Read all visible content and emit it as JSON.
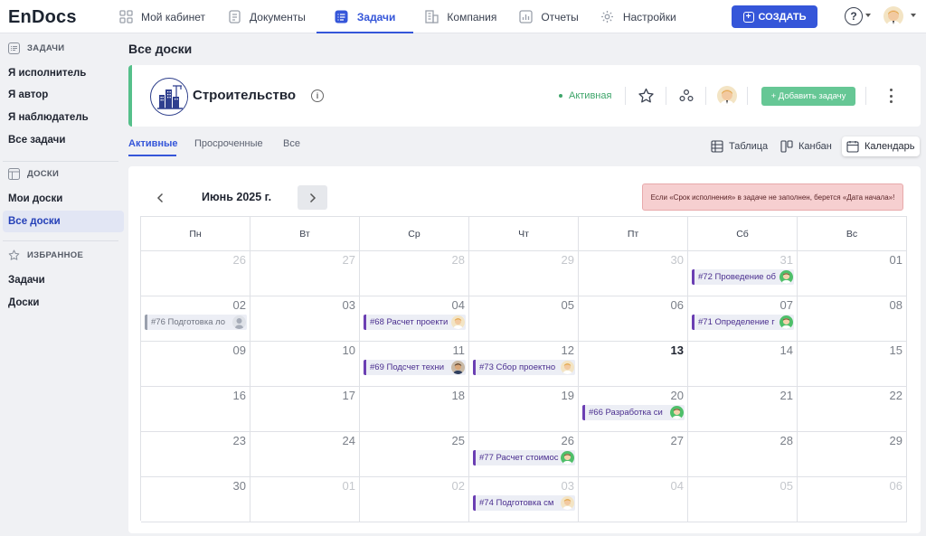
{
  "app": {
    "logo": "EnDocs"
  },
  "nav": {
    "items": [
      {
        "label": "Мой кабинет",
        "icon": "grid-icon"
      },
      {
        "label": "Документы",
        "icon": "document-icon"
      },
      {
        "label": "Задачи",
        "icon": "tasks-icon",
        "active": true
      },
      {
        "label": "Компания",
        "icon": "building-icon"
      },
      {
        "label": "Отчеты",
        "icon": "chart-icon"
      },
      {
        "label": "Настройки",
        "icon": "gear-icon"
      }
    ],
    "create_label": "СОЗДАТЬ",
    "help_label": "?"
  },
  "sidebar": {
    "tasks_heading": "ЗАДАЧИ",
    "tasks_items": [
      "Я исполнитель",
      "Я автор",
      "Я наблюдатель",
      "Все задачи"
    ],
    "boards_heading": "ДОСКИ",
    "boards_items": [
      "Мои доски",
      "Все доски"
    ],
    "favorites_heading": "ИЗБРАННОЕ",
    "favorites_items": [
      "Задачи",
      "Доски"
    ]
  },
  "page": {
    "title": "Все доски"
  },
  "board": {
    "name": "Строительство",
    "info": "i",
    "status": "Активная",
    "add_task_label": "+ Добавить задачу"
  },
  "tabs": [
    "Активные",
    "Просроченные",
    "Все"
  ],
  "views": [
    "Таблица",
    "Канбан",
    "Календарь"
  ],
  "calendar": {
    "month_label": "Июнь 2025 г.",
    "note": "Если «Срок исполнения» в задаче не заполнен, берется «Дата начала»!",
    "weekdays": [
      "Пн",
      "Вт",
      "Ср",
      "Чт",
      "Пт",
      "Сб",
      "Вс"
    ],
    "weeks": [
      [
        "26",
        "27",
        "28",
        "29",
        "30",
        "31",
        "01"
      ],
      [
        "02",
        "03",
        "04",
        "05",
        "06",
        "07",
        "08"
      ],
      [
        "09",
        "10",
        "11",
        "12",
        "13",
        "14",
        "15"
      ],
      [
        "16",
        "17",
        "18",
        "19",
        "20",
        "21",
        "22"
      ],
      [
        "23",
        "24",
        "25",
        "26",
        "27",
        "28",
        "29"
      ],
      [
        "30",
        "01",
        "02",
        "03",
        "04",
        "05",
        "06"
      ]
    ],
    "tasks": [
      {
        "label": "#72 Проведение об",
        "week": 0,
        "day": 5,
        "avatar": "green"
      },
      {
        "label": "#76 Подготовка ло",
        "week": 1,
        "day": 0,
        "avatar": "gray",
        "style": "gray"
      },
      {
        "label": "#68 Расчет проекти",
        "week": 1,
        "day": 2,
        "avatar": "blond"
      },
      {
        "label": "#71 Определение г",
        "week": 1,
        "day": 5,
        "avatar": "green"
      },
      {
        "label": "#69 Подсчет техни",
        "week": 2,
        "day": 2,
        "avatar": "dark"
      },
      {
        "label": "#73 Сбор проектно",
        "week": 2,
        "day": 3,
        "avatar": "blond"
      },
      {
        "label": "#66 Разработка си",
        "week": 3,
        "day": 4,
        "avatar": "green"
      },
      {
        "label": "#77 Расчет стоимос",
        "week": 4,
        "day": 3,
        "avatar": "green"
      },
      {
        "label": "#74 Подготовка см",
        "week": 5,
        "day": 3,
        "avatar": "blond"
      }
    ]
  },
  "colors": {
    "accent": "#3556d9",
    "green": "#55c08a",
    "task_border": "#6b3fb3",
    "note_bg": "#f6cfd0"
  }
}
